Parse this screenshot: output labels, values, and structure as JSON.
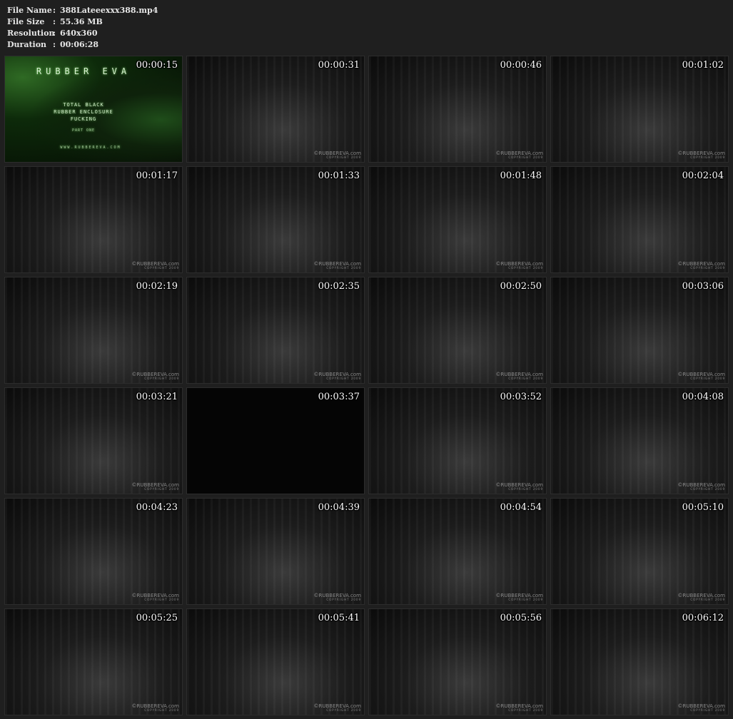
{
  "info": {
    "file_name_label": "File Name",
    "file_name": "388Lateeexxx388.mp4",
    "file_size_label": "File Size",
    "file_size": "55.36 MB",
    "resolution_label": "Resolution",
    "resolution": "640x360",
    "duration_label": "Duration",
    "duration": "00:06:28",
    "separator": ":"
  },
  "title_card": {
    "logo": "RUBBER EVA",
    "line1": "TOTAL BLACK",
    "line2": "RUBBER ENCLOSURE",
    "line3": "FUCKING",
    "part": "PART ONE",
    "url": "WWW.RUBBEREVA.COM"
  },
  "watermark": {
    "brand": "©RUBBEREVA.com",
    "copyright": "COPYRIGHT 2009"
  },
  "thumbnails": [
    {
      "time": "00:00:15"
    },
    {
      "time": "00:00:31"
    },
    {
      "time": "00:00:46"
    },
    {
      "time": "00:01:02"
    },
    {
      "time": "00:01:17"
    },
    {
      "time": "00:01:33"
    },
    {
      "time": "00:01:48"
    },
    {
      "time": "00:02:04"
    },
    {
      "time": "00:02:19"
    },
    {
      "time": "00:02:35"
    },
    {
      "time": "00:02:50"
    },
    {
      "time": "00:03:06"
    },
    {
      "time": "00:03:21"
    },
    {
      "time": "00:03:37"
    },
    {
      "time": "00:03:52"
    },
    {
      "time": "00:04:08"
    },
    {
      "time": "00:04:23"
    },
    {
      "time": "00:04:39"
    },
    {
      "time": "00:04:54"
    },
    {
      "time": "00:05:10"
    },
    {
      "time": "00:05:25"
    },
    {
      "time": "00:05:41"
    },
    {
      "time": "00:05:56"
    },
    {
      "time": "00:06:12"
    }
  ]
}
